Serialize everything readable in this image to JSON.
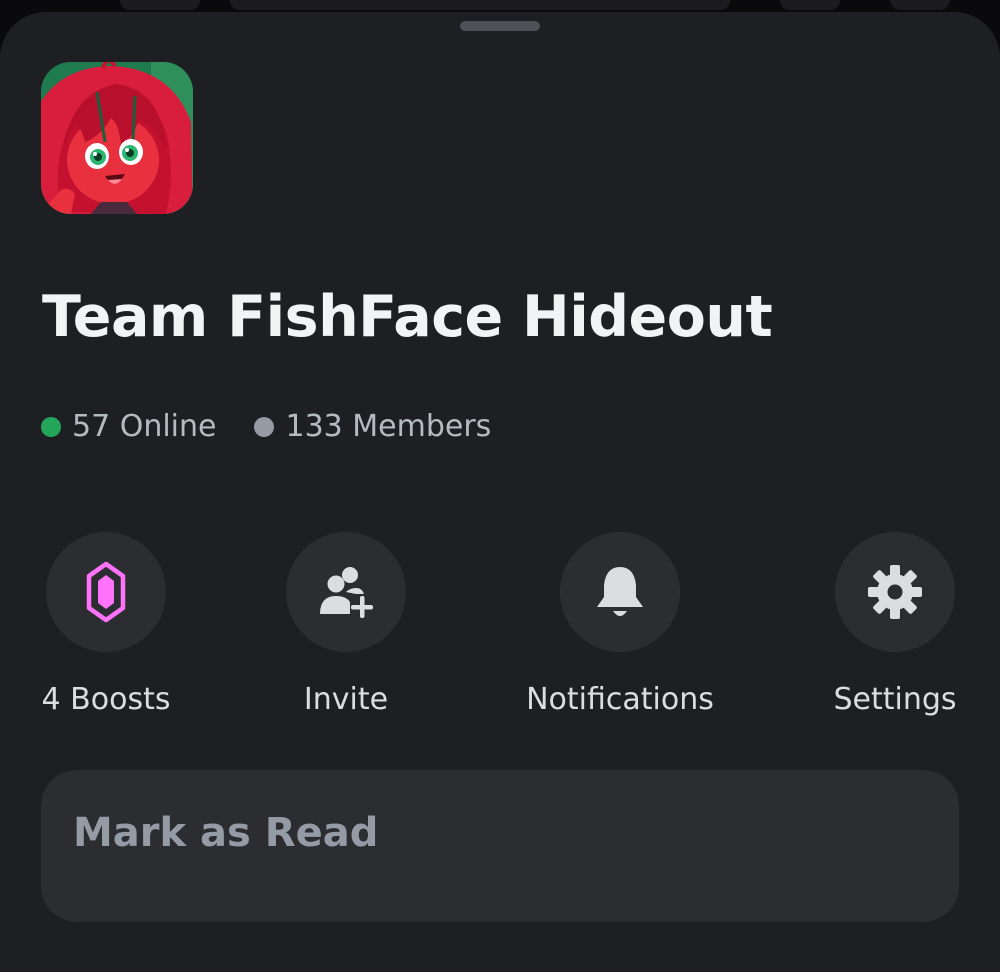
{
  "server": {
    "name": "Team FishFace Hideout",
    "online_text": "57 Online",
    "members_text": "133 Members",
    "icon": "server-avatar-image"
  },
  "actions": [
    {
      "label": "4 Boosts",
      "icon": "boost-gem-icon"
    },
    {
      "label": "Invite",
      "icon": "invite-user-icon"
    },
    {
      "label": "Notifications",
      "icon": "bell-icon"
    },
    {
      "label": "Settings",
      "icon": "gear-icon"
    }
  ],
  "mark_as_read": {
    "label": "Mark as Read"
  },
  "colors": {
    "sheet_background": "#1e1f22",
    "button_background": "#2b2d31",
    "online_dot": "#23a55a",
    "members_dot": "#949ba4",
    "boost_pink": "#ff73fa",
    "primary_text": "#f2f3f5",
    "secondary_text": "#b5bac1"
  }
}
